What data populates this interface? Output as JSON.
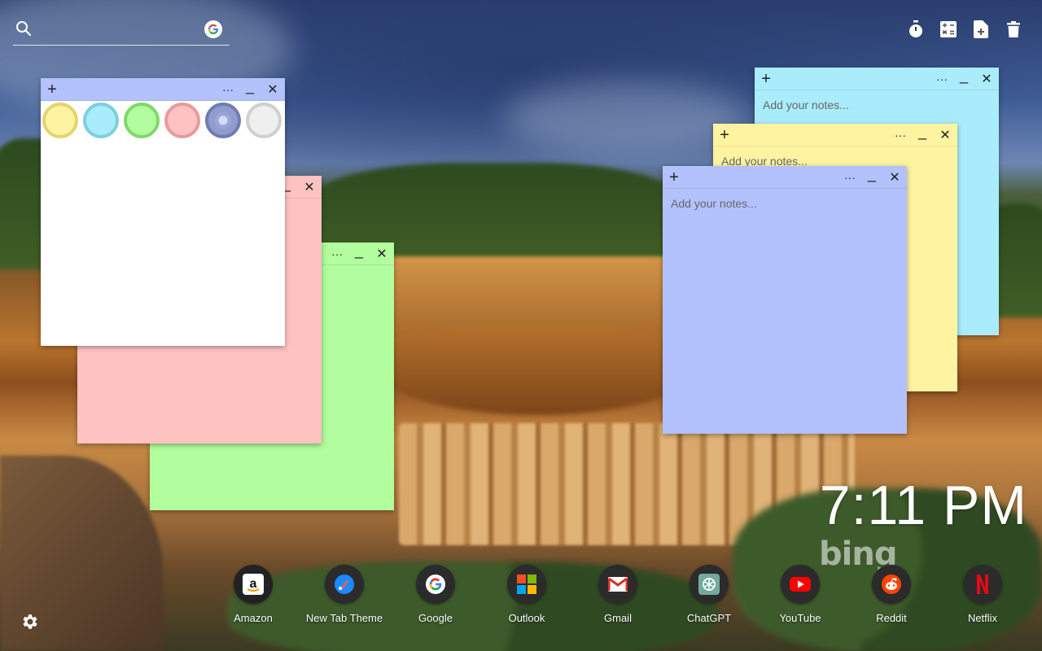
{
  "search": {
    "placeholder": "",
    "value": "",
    "icon": "search-icon",
    "engine_icon": "google-icon"
  },
  "toolbar": {
    "tools": [
      {
        "name": "timer-icon"
      },
      {
        "name": "calculator-icon"
      },
      {
        "name": "new-note-icon"
      },
      {
        "name": "trash-icon"
      }
    ]
  },
  "notes": {
    "white": {
      "color": "#ffffff",
      "placeholder": ""
    },
    "pink": {
      "color": "#ffc2c2",
      "placeholder": ""
    },
    "green": {
      "color": "#b2fd9d",
      "placeholder": ""
    },
    "cyan": {
      "color": "#a9ecfb",
      "placeholder": "Add your notes..."
    },
    "yellow": {
      "color": "#fdf3a1",
      "placeholder": "Add your notes..."
    },
    "lavender": {
      "color": "#b3c1fc",
      "placeholder": "Add your notes..."
    },
    "header_glyphs": {
      "add": "+",
      "more": "···",
      "minimize": "_",
      "close": "✕"
    }
  },
  "color_picker": {
    "swatches": [
      {
        "name": "yellow",
        "fill": "#fdf3a1",
        "ring": "#e3d56e"
      },
      {
        "name": "cyan",
        "fill": "#a9ecfb",
        "ring": "#7ccfe0"
      },
      {
        "name": "green",
        "fill": "#b2fd9d",
        "ring": "#7fd96a"
      },
      {
        "name": "pink",
        "fill": "#ffc2c2",
        "ring": "#e89a9a"
      },
      {
        "name": "lavender",
        "fill": "#8f9ccc",
        "ring": "#6f7cb0",
        "selected": true
      },
      {
        "name": "gray",
        "fill": "#efefef",
        "ring": "#cfcfcf"
      }
    ]
  },
  "clock": {
    "time": "7:11 PM"
  },
  "branding": {
    "logo_text": "bing"
  },
  "dock": [
    {
      "label": "Amazon",
      "icon": "amazon-icon"
    },
    {
      "label": "New Tab Theme",
      "icon": "new-tab-theme-icon"
    },
    {
      "label": "Google",
      "icon": "google-icon"
    },
    {
      "label": "Outlook",
      "icon": "outlook-icon"
    },
    {
      "label": "Gmail",
      "icon": "gmail-icon"
    },
    {
      "label": "ChatGPT",
      "icon": "chatgpt-icon"
    },
    {
      "label": "YouTube",
      "icon": "youtube-icon"
    },
    {
      "label": "Reddit",
      "icon": "reddit-icon"
    },
    {
      "label": "Netflix",
      "icon": "netflix-icon"
    }
  ],
  "settings": {
    "icon": "gear-icon"
  }
}
